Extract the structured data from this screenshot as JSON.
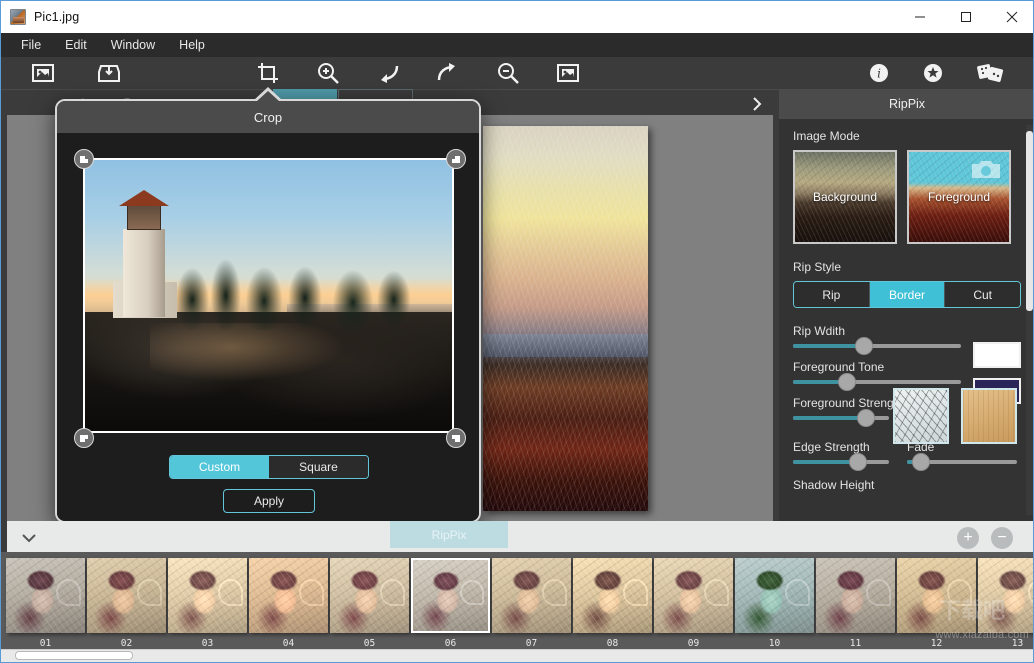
{
  "window": {
    "title": "Pic1.jpg",
    "icon": "photo-thumbnail-icon",
    "minimize_label": "─",
    "maximize_label": "□",
    "close_label": "✕"
  },
  "menubar": {
    "items": [
      {
        "label": "File"
      },
      {
        "label": "Edit"
      },
      {
        "label": "Window"
      },
      {
        "label": "Help"
      }
    ]
  },
  "toolbar": {
    "items": [
      {
        "name": "open-image-icon",
        "label": "Open Image"
      },
      {
        "name": "save-image-icon",
        "label": "Save Image"
      },
      {
        "name": "crop-icon",
        "label": "Crop"
      },
      {
        "name": "zoom-in-icon",
        "label": "Zoom In"
      },
      {
        "name": "undo-icon",
        "label": "Undo"
      },
      {
        "name": "redo-icon",
        "label": "Redo"
      },
      {
        "name": "zoom-out-icon",
        "label": "Zoom Out"
      },
      {
        "name": "fit-image-icon",
        "label": "Fit Image"
      },
      {
        "name": "info-icon",
        "label": "Info"
      },
      {
        "name": "settings-icon",
        "label": "Settings"
      },
      {
        "name": "effects-icon",
        "label": "Effects"
      }
    ]
  },
  "crop_dialog": {
    "title": "Crop",
    "handles": [
      "top-left",
      "top-right",
      "bottom-left",
      "bottom-right"
    ],
    "ratio_options": [
      {
        "label": "Custom",
        "active": true
      },
      {
        "label": "Square",
        "active": false
      }
    ],
    "apply_label": "Apply"
  },
  "sidebar": {
    "title": "RipPix",
    "collapse_icon": "chevron-right-icon",
    "sections": {
      "image_mode": {
        "label": "Image Mode",
        "options": [
          {
            "label": "Background",
            "selected": false
          },
          {
            "label": "Foreground",
            "selected": true,
            "badge_icon": "camera-icon"
          }
        ]
      },
      "rip_style": {
        "label": "Rip Style",
        "options": [
          {
            "label": "Rip",
            "active": false
          },
          {
            "label": "Border",
            "active": true
          },
          {
            "label": "Cut",
            "active": false
          }
        ]
      },
      "rip_width": {
        "label": "Rip Wdith",
        "value_pct": 42,
        "swatch_color": "#ffffff"
      },
      "foreground_tone": {
        "label": "Foreground Tone",
        "value_pct": 32,
        "swatch_color": "#2a2458"
      },
      "foreground_strength": {
        "label": "Foreground Strength",
        "value_pct": 76,
        "textures": [
          {
            "name": "paper-crumple-texture",
            "selected": true
          },
          {
            "name": "wood-grain-texture",
            "selected": false
          }
        ]
      },
      "edge_strength": {
        "label": "Edge Strength",
        "value_pct": 68
      },
      "fade": {
        "label": "Fade",
        "value_pct": 13
      },
      "shadow_height": {
        "label": "Shadow Height"
      }
    }
  },
  "filmstrip": {
    "tab_label": "RipPix",
    "collapse_icon": "chevron-down-icon",
    "add_label": "+",
    "remove_label": "−",
    "selected_index": 5,
    "items": [
      {
        "caption": "01"
      },
      {
        "caption": "02"
      },
      {
        "caption": "03"
      },
      {
        "caption": "04"
      },
      {
        "caption": "05"
      },
      {
        "caption": "06"
      },
      {
        "caption": "07"
      },
      {
        "caption": "08"
      },
      {
        "caption": "09"
      },
      {
        "caption": "10"
      },
      {
        "caption": "11"
      },
      {
        "caption": "12"
      },
      {
        "caption": "13"
      }
    ]
  },
  "watermark": {
    "url": "www.xiazaiba.com",
    "brand": "下载吧"
  },
  "colors": {
    "accent": "#3fc0d6",
    "accent_dim": "#63c6d8",
    "panel_bg": "#333333",
    "toolbar_bg": "#3b3b3b",
    "canvas_bg": "#808080",
    "filmstrip_bg": "#5a5a5a",
    "titlebar_bg": "#ffffff"
  }
}
